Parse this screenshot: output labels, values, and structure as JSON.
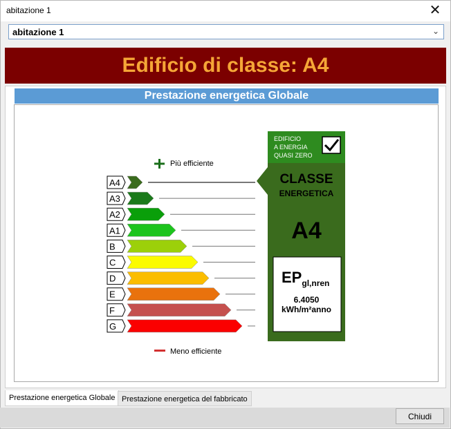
{
  "window": {
    "title": "abitazione 1"
  },
  "selector": {
    "value": "abitazione 1"
  },
  "banner": {
    "text": "Edificio di classe: A4"
  },
  "panel": {
    "header": "Prestazione energetica Globale"
  },
  "scale": {
    "top_label": "Più efficiente",
    "bottom_label": "Meno efficiente",
    "classes": [
      {
        "label": "A4",
        "color": "#3a6b1d"
      },
      {
        "label": "A3",
        "color": "#1b7a1b"
      },
      {
        "label": "A2",
        "color": "#0a9f0a"
      },
      {
        "label": "A1",
        "color": "#1dc41d"
      },
      {
        "label": "B",
        "color": "#9cd00a"
      },
      {
        "label": "C",
        "color": "#fbfb00"
      },
      {
        "label": "D",
        "color": "#fbbd00"
      },
      {
        "label": "E",
        "color": "#e9720d"
      },
      {
        "label": "F",
        "color": "#c5504e"
      },
      {
        "label": "G",
        "color": "#fb0000"
      }
    ],
    "selected": "A4"
  },
  "badge": {
    "nzeb_line1": "EDIFICIO",
    "nzeb_line2": "A ENERGIA",
    "nzeb_line3": "QUASI ZERO",
    "nzeb_checked": true,
    "classe_title": "CLASSE",
    "classe_sub": "ENERGETICA",
    "classe_value": "A4",
    "ep_main": "EP",
    "ep_sub": "gl,nren",
    "ep_value": "6.4050",
    "ep_unit": "kWh/m²anno",
    "color": "#3a6b1d"
  },
  "tabs": [
    {
      "label": "Prestazione energetica Globale"
    },
    {
      "label": "Prestazione energetica del fabbricato"
    }
  ],
  "buttons": {
    "close": "Chiudi"
  }
}
